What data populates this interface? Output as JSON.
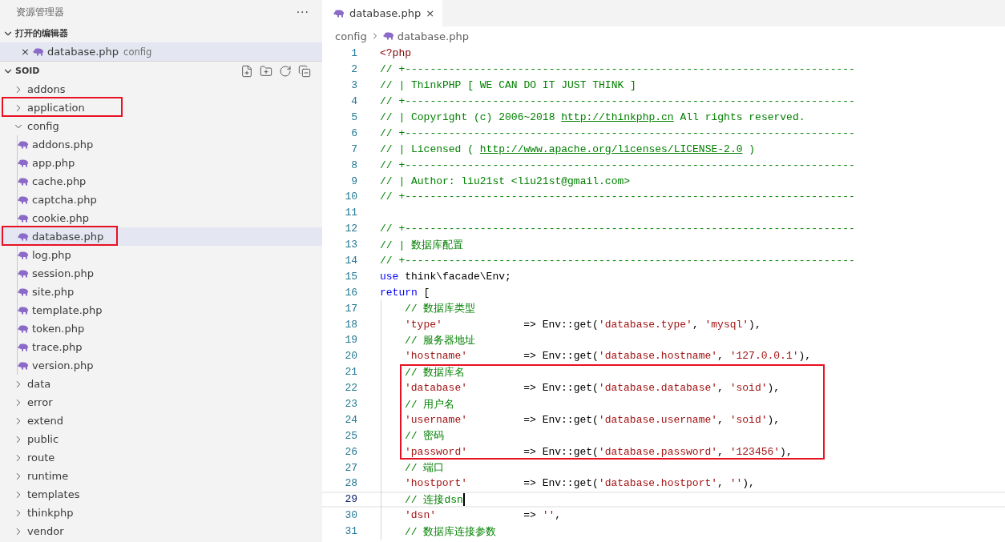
{
  "sidebar": {
    "title": "资源管理器",
    "more": "···",
    "open_editors": {
      "label": "打开的编辑器",
      "expanded": true,
      "items": [
        {
          "name": "database.php",
          "folder": "config",
          "close": "×",
          "selected": true
        }
      ]
    },
    "project": {
      "label": "SOID",
      "expanded": true,
      "tree": [
        {
          "name": "addons",
          "kind": "folder",
          "expanded": false,
          "selected": false,
          "annotated": false
        },
        {
          "name": "application",
          "kind": "folder",
          "expanded": false,
          "selected": false,
          "annotated": true
        },
        {
          "name": "config",
          "kind": "folder",
          "expanded": true,
          "selected": false,
          "annotated": false,
          "children": [
            {
              "name": "addons.php",
              "kind": "file",
              "selected": false,
              "annotated": false
            },
            {
              "name": "app.php",
              "kind": "file",
              "selected": false,
              "annotated": false
            },
            {
              "name": "cache.php",
              "kind": "file",
              "selected": false,
              "annotated": false
            },
            {
              "name": "captcha.php",
              "kind": "file",
              "selected": false,
              "annotated": false
            },
            {
              "name": "cookie.php",
              "kind": "file",
              "selected": false,
              "annotated": false
            },
            {
              "name": "database.php",
              "kind": "file",
              "selected": true,
              "annotated": true
            },
            {
              "name": "log.php",
              "kind": "file",
              "selected": false,
              "annotated": false
            },
            {
              "name": "session.php",
              "kind": "file",
              "selected": false,
              "annotated": false
            },
            {
              "name": "site.php",
              "kind": "file",
              "selected": false,
              "annotated": false
            },
            {
              "name": "template.php",
              "kind": "file",
              "selected": false,
              "annotated": false
            },
            {
              "name": "token.php",
              "kind": "file",
              "selected": false,
              "annotated": false
            },
            {
              "name": "trace.php",
              "kind": "file",
              "selected": false,
              "annotated": false
            },
            {
              "name": "version.php",
              "kind": "file",
              "selected": false,
              "annotated": false
            }
          ]
        },
        {
          "name": "data",
          "kind": "folder",
          "expanded": false,
          "selected": false,
          "annotated": false
        },
        {
          "name": "error",
          "kind": "folder",
          "expanded": false,
          "selected": false,
          "annotated": false
        },
        {
          "name": "extend",
          "kind": "folder",
          "expanded": false,
          "selected": false,
          "annotated": false
        },
        {
          "name": "public",
          "kind": "folder",
          "expanded": false,
          "selected": false,
          "annotated": false
        },
        {
          "name": "route",
          "kind": "folder",
          "expanded": false,
          "selected": false,
          "annotated": false
        },
        {
          "name": "runtime",
          "kind": "folder",
          "expanded": false,
          "selected": false,
          "annotated": false
        },
        {
          "name": "templates",
          "kind": "folder",
          "expanded": false,
          "selected": false,
          "annotated": false
        },
        {
          "name": "thinkphp",
          "kind": "folder",
          "expanded": false,
          "selected": false,
          "annotated": false
        },
        {
          "name": "vendor",
          "kind": "folder",
          "expanded": false,
          "selected": false,
          "annotated": false
        }
      ]
    }
  },
  "tabs": [
    {
      "label": "database.php",
      "close": "×",
      "selected": true
    }
  ],
  "breadcrumb": [
    "config",
    "database.php"
  ],
  "code": {
    "lines": [
      {
        "number": "1",
        "indented": false,
        "current": false,
        "annotated": false,
        "tokens": [
          {
            "kind": "tag",
            "text": "<?php"
          }
        ]
      },
      {
        "number": "2",
        "indented": false,
        "current": false,
        "annotated": false,
        "tokens": [
          {
            "kind": "comment",
            "text": "// +------------------------------------------------------------------------"
          }
        ]
      },
      {
        "number": "3",
        "indented": false,
        "current": false,
        "annotated": false,
        "tokens": [
          {
            "kind": "comment",
            "text": "// | ThinkPHP [ WE CAN DO IT JUST THINK ]"
          }
        ]
      },
      {
        "number": "4",
        "indented": false,
        "current": false,
        "annotated": false,
        "tokens": [
          {
            "kind": "comment",
            "text": "// +------------------------------------------------------------------------"
          }
        ]
      },
      {
        "number": "5",
        "indented": false,
        "current": false,
        "annotated": false,
        "tokens": [
          {
            "kind": "comment",
            "text": "// | Copyright (c) 2006~2018 "
          },
          {
            "kind": "link",
            "text": "http://thinkphp.cn"
          },
          {
            "kind": "comment",
            "text": " All rights reserved."
          }
        ]
      },
      {
        "number": "6",
        "indented": false,
        "current": false,
        "annotated": false,
        "tokens": [
          {
            "kind": "comment",
            "text": "// +------------------------------------------------------------------------"
          }
        ]
      },
      {
        "number": "7",
        "indented": false,
        "current": false,
        "annotated": false,
        "tokens": [
          {
            "kind": "comment",
            "text": "// | Licensed ( "
          },
          {
            "kind": "link",
            "text": "http://www.apache.org/licenses/LICENSE-2.0"
          },
          {
            "kind": "comment",
            "text": " )"
          }
        ]
      },
      {
        "number": "8",
        "indented": false,
        "current": false,
        "annotated": false,
        "tokens": [
          {
            "kind": "comment",
            "text": "// +------------------------------------------------------------------------"
          }
        ]
      },
      {
        "number": "9",
        "indented": false,
        "current": false,
        "annotated": false,
        "tokens": [
          {
            "kind": "comment",
            "text": "// | Author: liu21st <liu21st@gmail.com>"
          }
        ]
      },
      {
        "number": "10",
        "indented": false,
        "current": false,
        "annotated": false,
        "tokens": [
          {
            "kind": "comment",
            "text": "// +------------------------------------------------------------------------"
          }
        ]
      },
      {
        "number": "11",
        "indented": false,
        "current": false,
        "annotated": false
      },
      {
        "number": "12",
        "indented": false,
        "current": false,
        "annotated": false,
        "tokens": [
          {
            "kind": "comment",
            "text": "// +------------------------------------------------------------------------"
          }
        ]
      },
      {
        "number": "13",
        "indented": false,
        "current": false,
        "annotated": false,
        "tokens": [
          {
            "kind": "comment",
            "text": "// | 数据库配置"
          }
        ]
      },
      {
        "number": "14",
        "indented": false,
        "current": false,
        "annotated": false,
        "tokens": [
          {
            "kind": "comment",
            "text": "// +------------------------------------------------------------------------"
          }
        ]
      },
      {
        "number": "15",
        "indented": false,
        "current": false,
        "annotated": false,
        "tokens": [
          {
            "kind": "keyword",
            "text": "use"
          },
          {
            "kind": "plain",
            "text": " think\\facade\\Env;"
          }
        ]
      },
      {
        "number": "16",
        "indented": false,
        "current": false,
        "annotated": false,
        "tokens": [
          {
            "kind": "keyword",
            "text": "return"
          },
          {
            "kind": "plain",
            "text": " ["
          }
        ]
      },
      {
        "number": "17",
        "indented": true,
        "current": false,
        "annotated": false,
        "tokens": [
          {
            "kind": "comment",
            "text": "// 数据库类型"
          }
        ]
      },
      {
        "number": "18",
        "indented": true,
        "current": false,
        "annotated": false,
        "tokens": [
          {
            "kind": "string",
            "text": "'type'"
          },
          {
            "kind": "plain",
            "text": "             => Env::get("
          },
          {
            "kind": "string",
            "text": "'database.type'"
          },
          {
            "kind": "plain",
            "text": ", "
          },
          {
            "kind": "string",
            "text": "'mysql'"
          },
          {
            "kind": "plain",
            "text": "),"
          }
        ]
      },
      {
        "number": "19",
        "indented": true,
        "current": false,
        "annotated": false,
        "tokens": [
          {
            "kind": "comment",
            "text": "// 服务器地址"
          }
        ]
      },
      {
        "number": "20",
        "indented": true,
        "current": false,
        "annotated": false,
        "tokens": [
          {
            "kind": "string",
            "text": "'hostname'"
          },
          {
            "kind": "plain",
            "text": "         => Env::get("
          },
          {
            "kind": "string",
            "text": "'database.hostname'"
          },
          {
            "kind": "plain",
            "text": ", "
          },
          {
            "kind": "string",
            "text": "'127.0.0.1'"
          },
          {
            "kind": "plain",
            "text": "),"
          }
        ]
      },
      {
        "number": "21",
        "indented": true,
        "current": false,
        "annotated": true,
        "tokens": [
          {
            "kind": "comment",
            "text": "// 数据库名"
          }
        ]
      },
      {
        "number": "22",
        "indented": true,
        "current": false,
        "annotated": true,
        "tokens": [
          {
            "kind": "string",
            "text": "'database'"
          },
          {
            "kind": "plain",
            "text": "         => Env::get("
          },
          {
            "kind": "string",
            "text": "'database.database'"
          },
          {
            "kind": "plain",
            "text": ", "
          },
          {
            "kind": "string",
            "text": "'soid'"
          },
          {
            "kind": "plain",
            "text": "),"
          }
        ]
      },
      {
        "number": "23",
        "indented": true,
        "current": false,
        "annotated": true,
        "tokens": [
          {
            "kind": "comment",
            "text": "// 用户名"
          }
        ]
      },
      {
        "number": "24",
        "indented": true,
        "current": false,
        "annotated": true,
        "tokens": [
          {
            "kind": "string",
            "text": "'username'"
          },
          {
            "kind": "plain",
            "text": "         => Env::get("
          },
          {
            "kind": "string",
            "text": "'database.username'"
          },
          {
            "kind": "plain",
            "text": ", "
          },
          {
            "kind": "string",
            "text": "'soid'"
          },
          {
            "kind": "plain",
            "text": "),"
          }
        ]
      },
      {
        "number": "25",
        "indented": true,
        "current": false,
        "annotated": true,
        "tokens": [
          {
            "kind": "comment",
            "text": "// 密码"
          }
        ]
      },
      {
        "number": "26",
        "indented": true,
        "current": false,
        "annotated": true,
        "tokens": [
          {
            "kind": "string",
            "text": "'password'"
          },
          {
            "kind": "plain",
            "text": "         => Env::get("
          },
          {
            "kind": "string",
            "text": "'database.password'"
          },
          {
            "kind": "plain",
            "text": ", "
          },
          {
            "kind": "string",
            "text": "'123456'"
          },
          {
            "kind": "plain",
            "text": "),"
          }
        ]
      },
      {
        "number": "27",
        "indented": true,
        "current": false,
        "annotated": false,
        "tokens": [
          {
            "kind": "comment",
            "text": "// 端口"
          }
        ]
      },
      {
        "number": "28",
        "indented": true,
        "current": false,
        "annotated": false,
        "tokens": [
          {
            "kind": "string",
            "text": "'hostport'"
          },
          {
            "kind": "plain",
            "text": "         => Env::get("
          },
          {
            "kind": "string",
            "text": "'database.hostport'"
          },
          {
            "kind": "plain",
            "text": ", "
          },
          {
            "kind": "string",
            "text": "''"
          },
          {
            "kind": "plain",
            "text": "),"
          }
        ]
      },
      {
        "number": "29",
        "indented": true,
        "current": true,
        "annotated": false,
        "tokens": [
          {
            "kind": "comment",
            "text": "// 连接dsn"
          }
        ]
      },
      {
        "number": "30",
        "indented": true,
        "current": false,
        "annotated": false,
        "tokens": [
          {
            "kind": "string",
            "text": "'dsn'"
          },
          {
            "kind": "plain",
            "text": "              => "
          },
          {
            "kind": "string",
            "text": "''"
          },
          {
            "kind": "plain",
            "text": ","
          }
        ]
      },
      {
        "number": "31",
        "indented": true,
        "current": false,
        "annotated": false,
        "tokens": [
          {
            "kind": "comment",
            "text": "// 数据库连接参数"
          }
        ]
      }
    ]
  }
}
